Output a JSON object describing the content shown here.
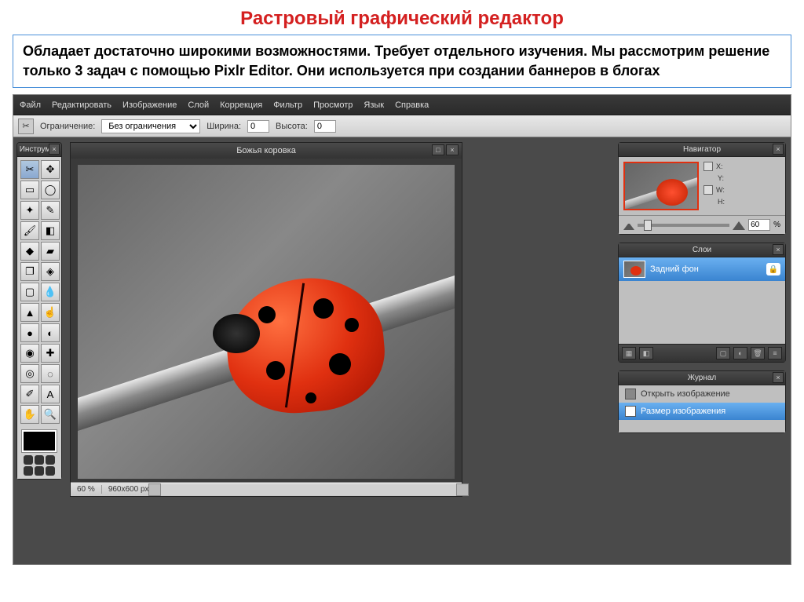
{
  "page": {
    "title": "Растровый графический редактор",
    "description": "Обладает достаточно широкими возможностями. Требует отдельного изучения. Мы рассмотрим решение только 3 задач с помощью Pixlr Editor. Они используется при создании баннеров в блогах"
  },
  "menubar": {
    "items": [
      "Файл",
      "Редактировать",
      "Изображение",
      "Слой",
      "Коррекция",
      "Фильтр",
      "Просмотр",
      "Язык",
      "Справка"
    ]
  },
  "optionsbar": {
    "constraint_label": "Ограничение:",
    "constraint_value": "Без ограничения",
    "width_label": "Ширина:",
    "width_value": "0",
    "height_label": "Высота:",
    "height_value": "0"
  },
  "tools_panel": {
    "title": "Инструмен",
    "tools": [
      {
        "name": "crop",
        "glyph": "✂"
      },
      {
        "name": "move",
        "glyph": "✥"
      },
      {
        "name": "marquee",
        "glyph": "▭"
      },
      {
        "name": "lasso",
        "glyph": "◯"
      },
      {
        "name": "wand",
        "glyph": "✦"
      },
      {
        "name": "pencil",
        "glyph": "✎"
      },
      {
        "name": "brush",
        "glyph": "🖌"
      },
      {
        "name": "eraser",
        "glyph": "◧"
      },
      {
        "name": "bucket",
        "glyph": "◆"
      },
      {
        "name": "gradient",
        "glyph": "▰"
      },
      {
        "name": "clone",
        "glyph": "❐"
      },
      {
        "name": "replace",
        "glyph": "◈"
      },
      {
        "name": "draw",
        "glyph": "▢"
      },
      {
        "name": "blur",
        "glyph": "💧"
      },
      {
        "name": "sharpen",
        "glyph": "▲"
      },
      {
        "name": "smudge",
        "glyph": "☝"
      },
      {
        "name": "sponge",
        "glyph": "●"
      },
      {
        "name": "dodge",
        "glyph": "◐"
      },
      {
        "name": "redeye",
        "glyph": "◉"
      },
      {
        "name": "spot",
        "glyph": "✚"
      },
      {
        "name": "bloat",
        "glyph": "◎"
      },
      {
        "name": "pinch",
        "glyph": "◌"
      },
      {
        "name": "picker",
        "glyph": "✐"
      },
      {
        "name": "type",
        "glyph": "A"
      },
      {
        "name": "hand",
        "glyph": "✋"
      },
      {
        "name": "zoom",
        "glyph": "🔍"
      }
    ]
  },
  "canvas": {
    "title": "Божья коровка",
    "zoom": "60",
    "zoom_unit": "%",
    "dimensions": "960x600 px"
  },
  "navigator": {
    "title": "Навигатор",
    "x_label": "X:",
    "y_label": "Y:",
    "w_label": "W:",
    "h_label": "H:",
    "zoom_value": "60",
    "zoom_unit": "%"
  },
  "layers": {
    "title": "Слои",
    "items": [
      {
        "name": "Задний фон",
        "locked": true
      }
    ]
  },
  "history": {
    "title": "Журнал",
    "items": [
      {
        "label": "Открыть изображение",
        "active": false
      },
      {
        "label": "Размер изображения",
        "active": true
      }
    ]
  }
}
